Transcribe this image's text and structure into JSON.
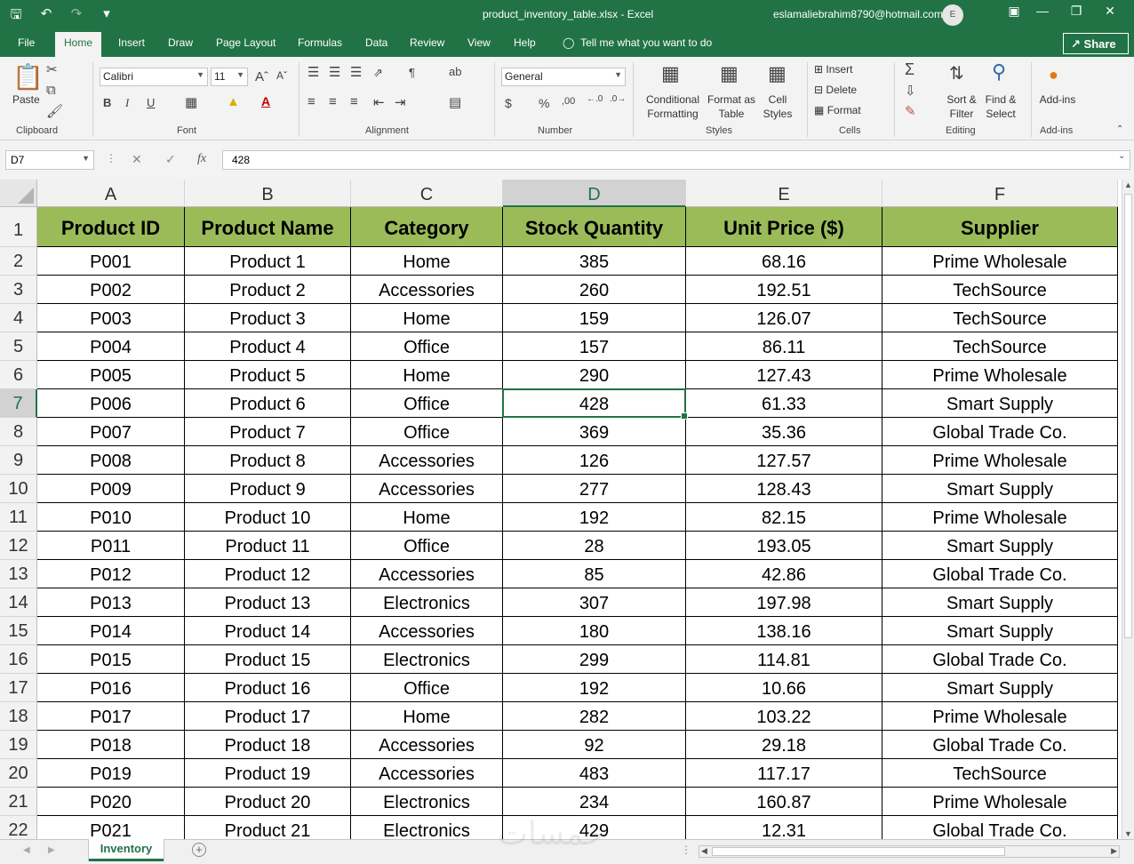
{
  "window": {
    "filename": "product_inventory_table.xlsx",
    "app": "Excel",
    "separator": "-",
    "account": "eslamaliebrahim8790@hotmail.com",
    "avatar_initial": "E"
  },
  "tabs": [
    "File",
    "Home",
    "Insert",
    "Draw",
    "Page Layout",
    "Formulas",
    "Data",
    "Review",
    "View",
    "Help"
  ],
  "active_tab": "Home",
  "tell_me": "Tell me what you want to do",
  "share_label": "Share",
  "ribbon": {
    "clipboard": {
      "paste": "Paste",
      "label": "Clipboard"
    },
    "font": {
      "name": "Calibri",
      "size": "11",
      "bold": "B",
      "italic": "I",
      "underline": "U",
      "label": "Font"
    },
    "alignment": {
      "label": "Alignment"
    },
    "number": {
      "format": "General",
      "currency": "$",
      "percent": "%",
      "label": "Number"
    },
    "styles": {
      "conditional_line1": "Conditional",
      "conditional_line2": "Formatting",
      "format_table_line1": "Format as",
      "format_table_line2": "Table",
      "cell_styles_line1": "Cell",
      "cell_styles_line2": "Styles",
      "label": "Styles"
    },
    "cells": {
      "insert": "Insert",
      "delete": "Delete",
      "format": "Format",
      "label": "Cells"
    },
    "editing": {
      "sort_line1": "Sort &",
      "sort_line2": "Filter",
      "find_line1": "Find &",
      "find_line2": "Select",
      "label": "Editing"
    },
    "addins": {
      "button": "Add-ins",
      "label": "Add-ins"
    }
  },
  "formula_bar": {
    "name_box": "D7",
    "fx": "fx",
    "value": "428"
  },
  "columns": [
    "A",
    "B",
    "C",
    "D",
    "E",
    "F"
  ],
  "selected_column": "D",
  "selected_row": "7",
  "header_fill": "#9bbb59",
  "accent": "#217346",
  "table": {
    "headers": [
      "Product ID",
      "Product Name",
      "Category",
      "Stock Quantity",
      "Unit Price ($)",
      "Supplier"
    ],
    "rows": [
      [
        "P001",
        "Product 1",
        "Home",
        "385",
        "68.16",
        "Prime Wholesale"
      ],
      [
        "P002",
        "Product 2",
        "Accessories",
        "260",
        "192.51",
        "TechSource"
      ],
      [
        "P003",
        "Product 3",
        "Home",
        "159",
        "126.07",
        "TechSource"
      ],
      [
        "P004",
        "Product 4",
        "Office",
        "157",
        "86.11",
        "TechSource"
      ],
      [
        "P005",
        "Product 5",
        "Home",
        "290",
        "127.43",
        "Prime Wholesale"
      ],
      [
        "P006",
        "Product 6",
        "Office",
        "428",
        "61.33",
        "Smart Supply"
      ],
      [
        "P007",
        "Product 7",
        "Office",
        "369",
        "35.36",
        "Global Trade Co."
      ],
      [
        "P008",
        "Product 8",
        "Accessories",
        "126",
        "127.57",
        "Prime Wholesale"
      ],
      [
        "P009",
        "Product 9",
        "Accessories",
        "277",
        "128.43",
        "Smart Supply"
      ],
      [
        "P010",
        "Product 10",
        "Home",
        "192",
        "82.15",
        "Prime Wholesale"
      ],
      [
        "P011",
        "Product 11",
        "Office",
        "28",
        "193.05",
        "Smart Supply"
      ],
      [
        "P012",
        "Product 12",
        "Accessories",
        "85",
        "42.86",
        "Global Trade Co."
      ],
      [
        "P013",
        "Product 13",
        "Electronics",
        "307",
        "197.98",
        "Smart Supply"
      ],
      [
        "P014",
        "Product 14",
        "Accessories",
        "180",
        "138.16",
        "Smart Supply"
      ],
      [
        "P015",
        "Product 15",
        "Electronics",
        "299",
        "114.81",
        "Global Trade Co."
      ],
      [
        "P016",
        "Product 16",
        "Office",
        "192",
        "10.66",
        "Smart Supply"
      ],
      [
        "P017",
        "Product 17",
        "Home",
        "282",
        "103.22",
        "Prime Wholesale"
      ],
      [
        "P018",
        "Product 18",
        "Accessories",
        "92",
        "29.18",
        "Global Trade Co."
      ],
      [
        "P019",
        "Product 19",
        "Accessories",
        "483",
        "117.17",
        "TechSource"
      ],
      [
        "P020",
        "Product 20",
        "Electronics",
        "234",
        "160.87",
        "Prime Wholesale"
      ],
      [
        "P021",
        "Product 21",
        "Electronics",
        "429",
        "12.31",
        "Global Trade Co."
      ]
    ]
  },
  "sheet_tab": "Inventory",
  "watermark": "خمسات"
}
